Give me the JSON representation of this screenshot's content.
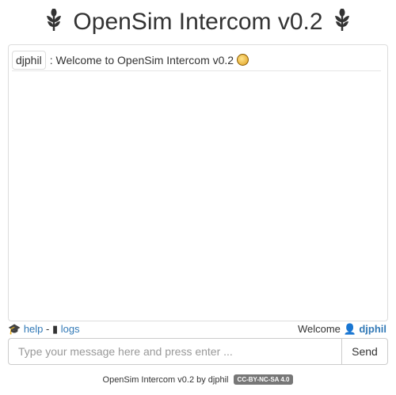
{
  "header": {
    "title": "OpenSim Intercom v0.2",
    "icon": "leaf-icon"
  },
  "messages": [
    {
      "nick": "djphil",
      "text": ": Welcome to OpenSim Intercom v0.2",
      "emoji": "smiley-icon"
    }
  ],
  "links": {
    "help": "help",
    "separator": "-",
    "logs": "logs"
  },
  "user": {
    "welcome": "Welcome",
    "name": "djphil"
  },
  "input": {
    "placeholder": "Type your message here and press enter ...",
    "value": "",
    "send": "Send"
  },
  "footer": {
    "text": "OpenSim Intercom v0.2 by djphil",
    "license": "CC-BY-NC-SA 4.0"
  }
}
